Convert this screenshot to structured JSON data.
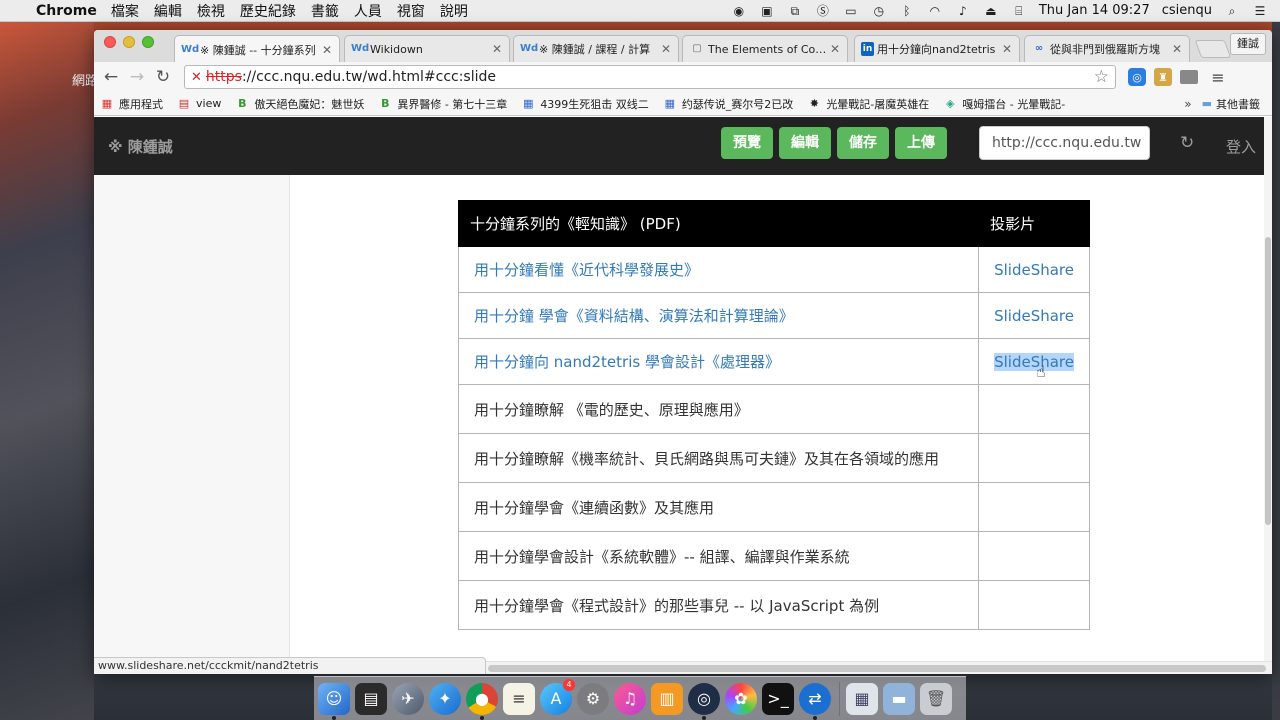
{
  "menubar": {
    "app": "Chrome",
    "items": [
      "檔案",
      "編輯",
      "檢視",
      "歷史紀錄",
      "書籤",
      "人員",
      "視窗",
      "說明"
    ],
    "clock": "Thu Jan 14  09:27",
    "user": "csienqu"
  },
  "desktop": {
    "fragment": "網路"
  },
  "tabs": [
    {
      "favicon": "Wd",
      "title": "※ 陳鍾誠 -- 十分鐘系列"
    },
    {
      "favicon": "Wd",
      "title": "Wikidown"
    },
    {
      "favicon": "Wd",
      "title": "※ 陳鍾誠 / 課程 / 計算"
    },
    {
      "favicon": "▢",
      "title": "The Elements of Comp"
    },
    {
      "favicon": "in",
      "title": "用十分鐘向nand2tetris"
    },
    {
      "favicon": "∞",
      "title": "從與非門到俄羅斯方塊"
    }
  ],
  "profile": "鍾誠",
  "omnibox": {
    "scheme": "https",
    "rest": "://ccc.nqu.edu.tw/wd.html#ccc:slide"
  },
  "bookmarks": [
    {
      "icon": "▦",
      "label": "應用程式"
    },
    {
      "icon": "▤",
      "label": "view"
    },
    {
      "icon": "B",
      "label": "傲天絕色魔妃：魅世妖"
    },
    {
      "icon": "B",
      "label": "異界醫修 - 第七十三章"
    },
    {
      "icon": "▦",
      "label": "4399生死狙击 双线二"
    },
    {
      "icon": "▦",
      "label": "约瑟传说_赛尔号2已改"
    },
    {
      "icon": "✸",
      "label": "光暈戰記-屠魔英雄在"
    },
    {
      "icon": "◈",
      "label": "嘎姆擂台 - 光暈戰記-"
    }
  ],
  "bookmarks_more": "»",
  "bookmarks_other": "其他書籤",
  "site": {
    "brand": "※ 陳鍾誠",
    "buttons": [
      "預覽",
      "編輯",
      "儲存",
      "上傳"
    ],
    "url_value": "http://ccc.nqu.edu.tw",
    "login": "登入"
  },
  "table": {
    "headers": [
      "十分鐘系列的《輕知識》 (PDF)",
      "投影片"
    ],
    "rows": [
      {
        "title": "用十分鐘看懂《近代科學發展史》",
        "slide": "SlideShare"
      },
      {
        "title": "用十分鐘 學會《資料結構、演算法和計算理論》",
        "slide": "SlideShare"
      },
      {
        "title": "用十分鐘向 nand2tetris 學會設計《處理器》",
        "slide": "SlideShare"
      },
      {
        "title": "用十分鐘瞭解 《電的歷史、原理與應用》",
        "slide": ""
      },
      {
        "title": "用十分鐘瞭解《機率統計、貝氏網路與馬可夫鏈》及其在各領域的應用",
        "slide": ""
      },
      {
        "title": "用十分鐘學會《連續函數》及其應用",
        "slide": ""
      },
      {
        "title": "用十分鐘學會設計《系統軟體》-- 組譯、編譯與作業系統",
        "slide": ""
      },
      {
        "title": "用十分鐘學會《程式設計》的那些事兒 -- 以 JavaScript 為例",
        "slide": ""
      }
    ]
  },
  "status_url": "www.slideshare.net/ccckmit/nand2tetris",
  "colors": {
    "nav_bg": "#222222",
    "button_green": "#5cb85c",
    "link_blue": "#337ab7",
    "selection": "#b4d5fe"
  }
}
